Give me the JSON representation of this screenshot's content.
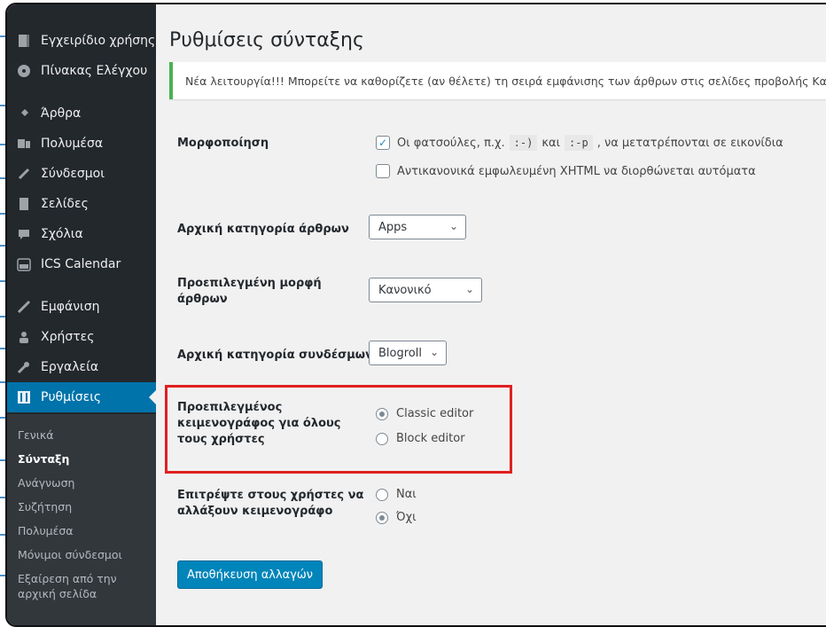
{
  "sidebar": {
    "items": [
      {
        "label": "Εγχειρίδιο χρήσης",
        "icon": "book-icon"
      },
      {
        "label": "Πίνακας Ελέγχου",
        "icon": "dashboard-icon"
      },
      {
        "label": "Άρθρα",
        "icon": "pin-icon"
      },
      {
        "label": "Πολυμέσα",
        "icon": "media-icon"
      },
      {
        "label": "Σύνδεσμοι",
        "icon": "link-icon"
      },
      {
        "label": "Σελίδες",
        "icon": "page-icon"
      },
      {
        "label": "Σχόλια",
        "icon": "comment-icon"
      },
      {
        "label": "ICS Calendar",
        "icon": "calendar-icon"
      },
      {
        "label": "Εμφάνιση",
        "icon": "brush-icon"
      },
      {
        "label": "Χρήστες",
        "icon": "users-icon"
      },
      {
        "label": "Εργαλεία",
        "icon": "wrench-icon"
      },
      {
        "label": "Ρυθμίσεις",
        "icon": "settings-icon"
      }
    ],
    "submenu": [
      "Γενικά",
      "Σύνταξη",
      "Ανάγνωση",
      "Συζήτηση",
      "Πολυμέσα",
      "Μόνιμοι σύνδεσμοι",
      "Εξαίρεση από την",
      "αρχική σελίδα"
    ]
  },
  "page": {
    "title": "Ρυθμίσεις σύνταξης",
    "notice": "Νέα λειτουργία!!! Μπορείτε να καθορίζετε (αν θέλετε) τη σειρά εμφάνισης των άρθρων στις σελίδες προβολής Κατηγορίας"
  },
  "formatting": {
    "label": "Μορφοποίηση",
    "opt1_a": "Οι φατσούλες, π.χ.",
    "opt1_code1": ":-)",
    "opt1_b": "και",
    "opt1_code2": ":-p",
    "opt1_c": ", να μετατρέπονται σε εικονίδια",
    "opt2": "Αντικανονικά εμφωλευμένη XHTML να διορθώνεται αυτόματα"
  },
  "post_category": {
    "label": "Αρχική κατηγορία άρθρων",
    "value": "Apps"
  },
  "post_format": {
    "label1": "Προεπιλεγμένη μορφή",
    "label2": "άρθρων",
    "value": "Κανονικό"
  },
  "link_category": {
    "label": "Αρχική κατηγορία συνδέσμων",
    "value": "Blogroll"
  },
  "editor": {
    "label1": "Προεπιλεγμένος",
    "label2": "κειμενογράφος για όλους",
    "label3": "τους χρήστες",
    "opt_classic": "Classic editor",
    "opt_block": "Block editor"
  },
  "allow_switch": {
    "label1": "Επιτρέψτε στους χρήστες να",
    "label2": "αλλάξουν κειμενογράφο",
    "opt_yes": "Ναι",
    "opt_no": "Όχι"
  },
  "save_label": "Αποθήκευση αλλαγών",
  "colors": {
    "accent": "#0073aa",
    "highlight": "#e02020",
    "notice": "#46b450"
  }
}
